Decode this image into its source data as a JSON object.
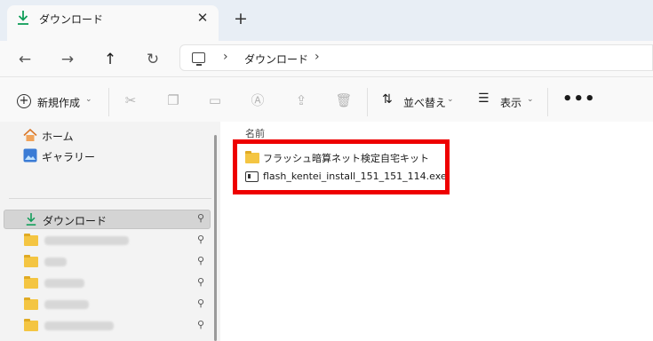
{
  "tab": {
    "title": "ダウンロード",
    "close": "✕",
    "new_tab": "+"
  },
  "nav": {
    "back": "←",
    "forward": "→",
    "up": "↑",
    "refresh": "↻"
  },
  "address": {
    "separator": "›",
    "location": "ダウンロード"
  },
  "commands": {
    "new_label": "新規作成",
    "sort_label": "並べ替え",
    "view_label": "表示",
    "more": "•••",
    "chevron": "⌄"
  },
  "sidebar": {
    "home": "ホーム",
    "gallery": "ギャラリー",
    "downloads": "ダウンロード",
    "pin": "📌"
  },
  "content": {
    "column_name": "名前",
    "files": [
      {
        "name": "フラッシュ暗算ネット検定自宅キット",
        "type": "folder"
      },
      {
        "name": "flash_kentei_install_151_151_114.exe",
        "type": "exe"
      }
    ]
  },
  "colors": {
    "highlight": "#ee0000",
    "folder": "#f4c542",
    "download_accent": "#0f9d58"
  }
}
